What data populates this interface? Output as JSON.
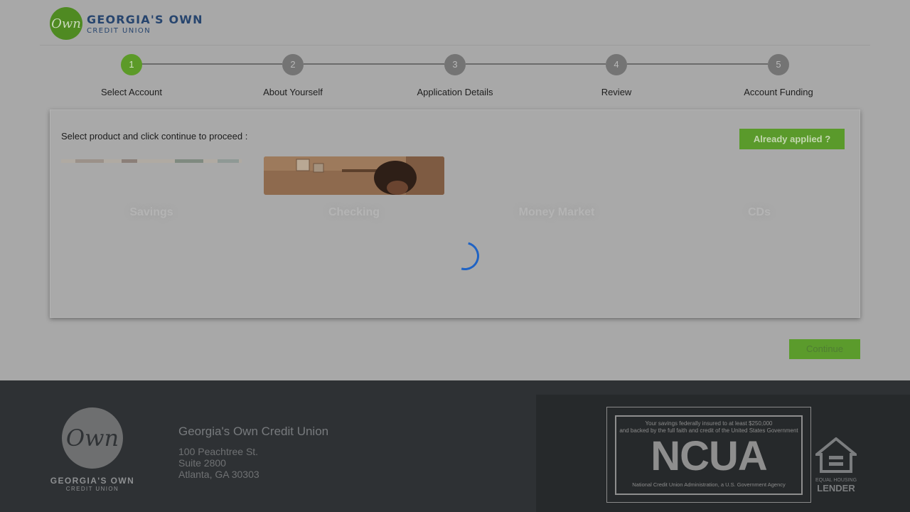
{
  "header": {
    "logo_mark": "Own",
    "logo_line1": "GEORGIA'S OWN",
    "logo_line2": "CREDIT UNION"
  },
  "steps": [
    {
      "number": "1",
      "label": "Select Account",
      "active": true
    },
    {
      "number": "2",
      "label": "About Yourself",
      "active": false
    },
    {
      "number": "3",
      "label": "Application Details",
      "active": false
    },
    {
      "number": "4",
      "label": "Review",
      "active": false
    },
    {
      "number": "5",
      "label": "Account Funding",
      "active": false
    }
  ],
  "card": {
    "instruction": "Select product and click continue to proceed :",
    "already_applied_label": "Already applied ?",
    "products": [
      {
        "label": "Savings"
      },
      {
        "label": "Checking"
      },
      {
        "label": "Money Market"
      },
      {
        "label": "CDs"
      }
    ]
  },
  "continue_label": "Continue",
  "footer": {
    "logo_mark": "Own",
    "logo_line1": "GEORGIA'S OWN",
    "logo_line2": "CREDIT UNION",
    "org_name": "Georgia's Own Credit Union",
    "address_line1": "100 Peachtree St.",
    "address_line2": "Suite 2800",
    "address_line3": "Atlanta, GA 30303",
    "ncua_top_line1": "Your savings federally insured to at least $250,000",
    "ncua_top_line2": "and backed by the full faith and credit of the United States Government",
    "ncua_big": "NCUA",
    "ncua_bottom": "National Credit Union Administration, a U.S. Government Agency",
    "ehl_line1": "EQUAL HOUSING",
    "ehl_line2": "LENDER"
  },
  "colors": {
    "brand_green": "#5a9a2b",
    "brand_blue": "#27456e",
    "spinner_blue": "#1f63c4",
    "footer_bg": "#2e3134"
  }
}
